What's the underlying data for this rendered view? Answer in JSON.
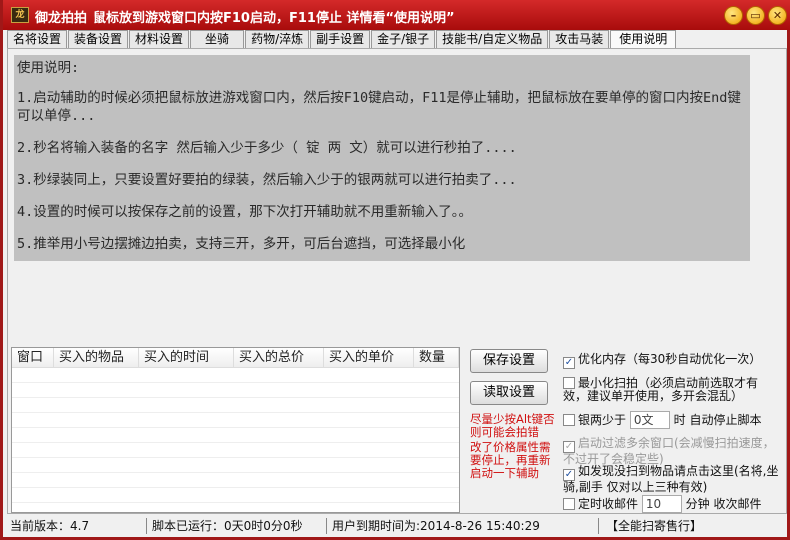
{
  "title": {
    "app_name": "御龙拍拍",
    "hint": "鼠标放到游戏窗口内按F10启动，F11停止 详情看“使用说明”"
  },
  "window_buttons": {
    "minimize": "–",
    "maximize": "▭",
    "close": "✕"
  },
  "tabs": [
    "名将设置",
    "装备设置",
    "材料设置",
    "坐骑",
    "药物/淬炼",
    "副手设置",
    "金子/银子",
    "技能书/自定义物品",
    "攻击马装",
    "使用说明"
  ],
  "help": {
    "heading": "使用说明:",
    "lines": [
      "1.启动辅助的时候必须把鼠标放进游戏窗口内，然后按F10键启动，F11是停止辅助，把鼠标放在要单停的窗口内按End键可以单停...",
      "2.秒名将输入装备的名字 然后输入少于多少（ 锭 两 文）就可以进行秒拍了....",
      "3.秒绿装同上，只要设置好要拍的绿装，然后输入少于的银两就可以进行拍卖了...",
      "4.设置的时候可以按保存之前的设置，那下次打开辅助就不用重新输入了。。",
      "5.推举用小号边摆摊边拍卖，支持三开，多开，可后台遮挡，可选择最小化"
    ]
  },
  "table": {
    "columns": [
      "窗口",
      "买入的物品",
      "买入的时间",
      "买入的总价",
      "买入的单价",
      "数量"
    ]
  },
  "buttons": {
    "save": "保存设置",
    "load": "读取设置"
  },
  "warnings": [
    "尽量少按Alt键否则可能会拍错",
    "改了价格属性需要停止，再重新启动一下辅助"
  ],
  "options": {
    "optimize": {
      "label": "优化内存（每30秒自动优化一次）",
      "checked": true
    },
    "minimize": {
      "label": "最小化扫拍（必须启动前选取才有效，建议单开使用，多开会混乱）",
      "checked": false
    },
    "silver": {
      "label": "银两少于",
      "value": "0文",
      "suffix": "时 自动停止脚本",
      "checked": false
    },
    "filter": {
      "label": "启动过滤多余窗口(会减慢扫拍速度，不过开了会稳定些)",
      "checked": true
    },
    "rescan": {
      "label": "如发现没扫到物品请点击这里(名将,坐骑,副手 仅对以上三种有效)",
      "checked": true
    },
    "mail": {
      "label": "定时收邮件",
      "value": "10",
      "suffix": "分钟 收次邮件",
      "checked": false
    }
  },
  "status": {
    "version": "当前版本：4.7",
    "runtime": "脚本已运行：0天0时0分0秒",
    "expiry": "用户到期时间为:2014-8-26 15:40:29",
    "shop": "【全能扫寄售行】"
  }
}
